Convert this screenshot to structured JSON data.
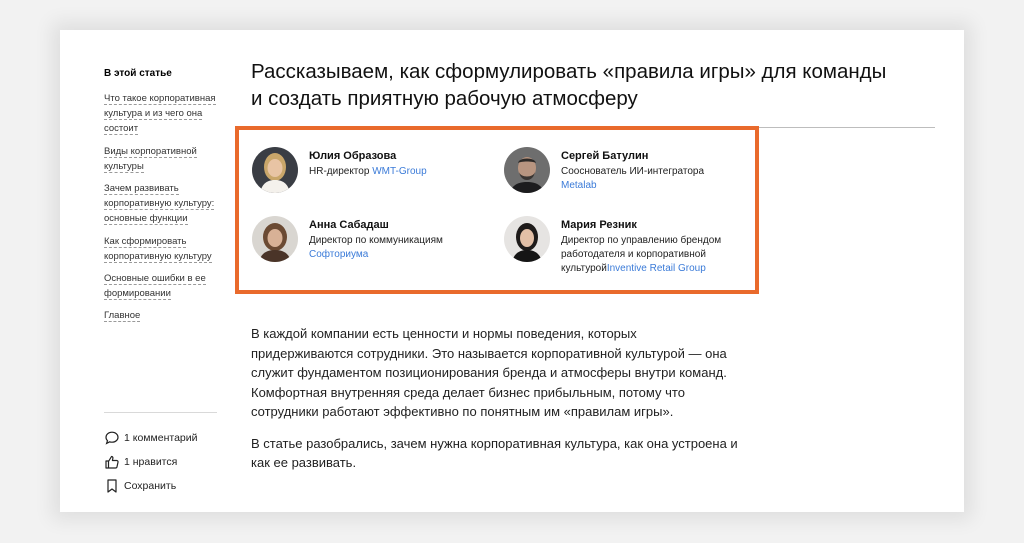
{
  "sidebar": {
    "toc_title": "В этой статье",
    "items": [
      "Что такое корпоративная культура и из чего она состоит",
      "Виды корпоративной культуры",
      "Зачем развивать корпоративную культуру: основные функции",
      "Как сформировать корпоративную культуру",
      "Основные ошибки в ее формировании",
      "Главное"
    ],
    "comments_label": "1 комментарий",
    "likes_label": "1 нравится",
    "save_label": "Сохранить"
  },
  "article": {
    "title": "Рассказываем, как сформулировать «правила игры» для команды и создать приятную рабочую атмосферу",
    "experts": [
      {
        "name": "Юлия Образова",
        "role": "HR-директор ",
        "company": "WMT-Group"
      },
      {
        "name": "Сергей Батулин",
        "role": "Сооснователь ИИ-интегратора",
        "company": "Metalab"
      },
      {
        "name": "Анна Сабадаш",
        "role": "Директор по коммуникациям",
        "company": "Софториума"
      },
      {
        "name": "Мария Резник",
        "role": "Директор по управлению брендом работодателя и корпоративной культурой",
        "company": "Inventive Retail Group"
      }
    ],
    "paragraphs": [
      "В каждой компании есть ценности и нормы поведения, которых придерживаются сотрудники. Это называется корпоративной культурой — она служит фундаментом позиционирования бренда и атмосферы внутри команд. Комфортная внутренняя среда делает бизнес прибыльным, потому что сотрудники работают эффективно по понятным им «правилам игры».",
      "В статье разобрались, зачем нужна корпоративная культура, как она устроена и как ее развивать."
    ]
  },
  "colors": {
    "accent_border": "#e96a2c",
    "link": "#3b7bd8"
  }
}
